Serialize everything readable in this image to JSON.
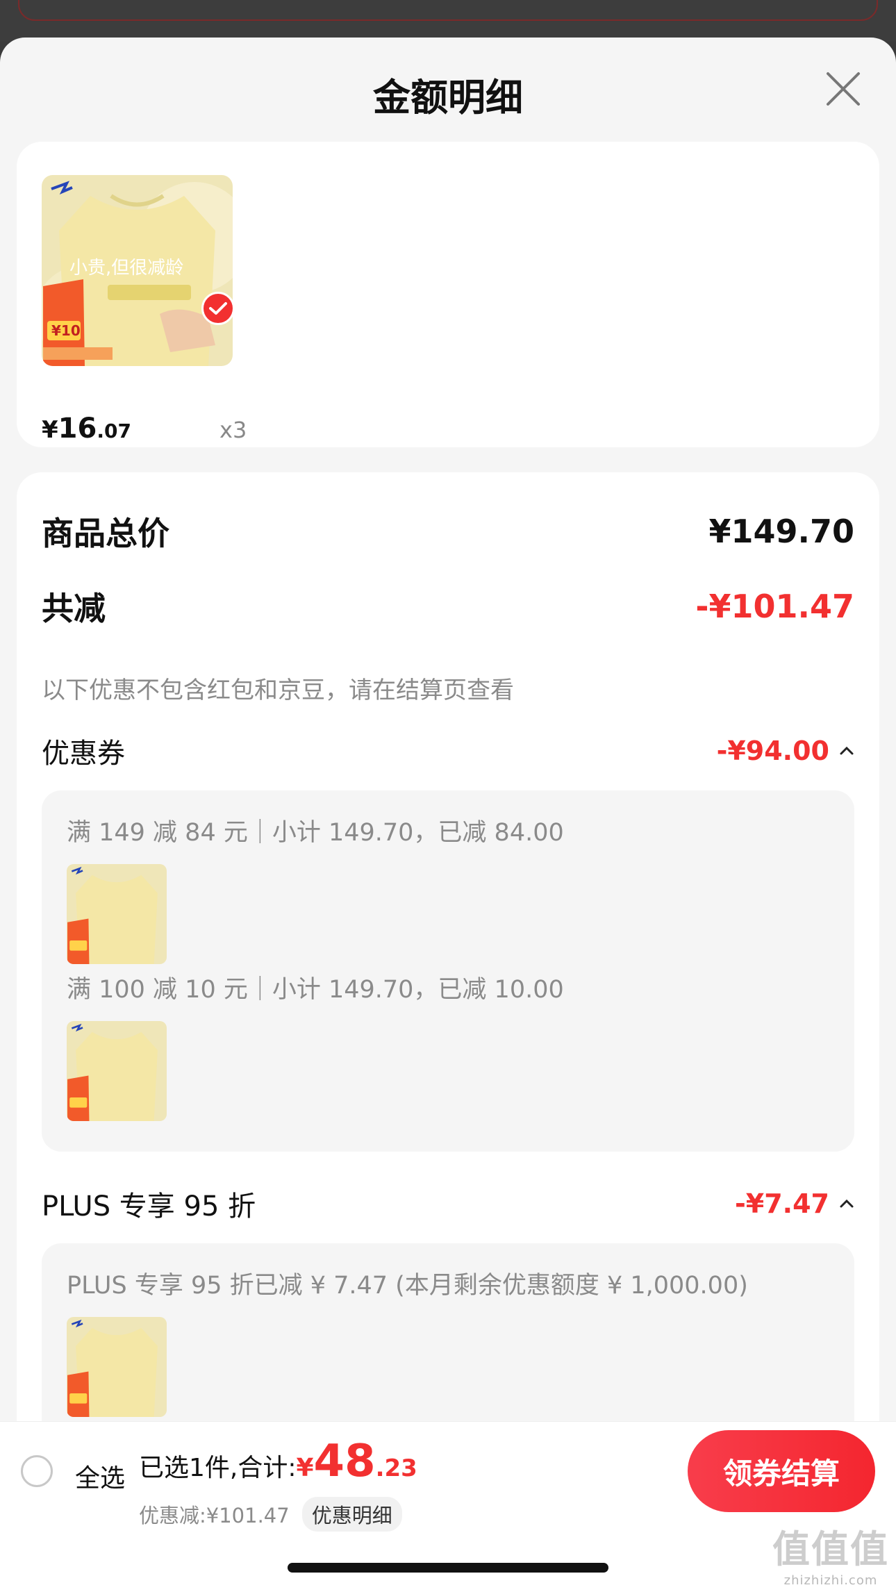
{
  "sheet": {
    "title": "金额明细"
  },
  "product": {
    "price_currency": "¥",
    "price_int": "16",
    "price_dec": ".07",
    "quantity": "x3",
    "image_text": "小贵,但很减龄"
  },
  "detail": {
    "total_label": "商品总价",
    "total_value": "¥149.70",
    "reduce_label": "共减",
    "reduce_value": "-¥101.47",
    "note": "以下优惠不包含红包和京豆，请在结算页查看",
    "coupon": {
      "label": "优惠券",
      "value": "-¥94.00",
      "lines": [
        "满 149 减 84 元｜小计 149.70，已减 84.00",
        "满 100 减 10 元｜小计 149.70，已减 10.00"
      ]
    },
    "plus": {
      "label": "PLUS 专享 95 折",
      "value": "-¥7.47",
      "lines": [
        "PLUS 专享 95 折已减 ¥ 7.47 (本月剩余优惠额度 ¥ 1,000.00)"
      ]
    }
  },
  "bottom": {
    "select_all": "全选",
    "summary_label": "已选1件,合计:",
    "currency": "¥",
    "total_int": "48",
    "total_dec": ".23",
    "discount_text": "优惠减:¥101.47",
    "detail_link": "优惠明细",
    "checkout": "领券结算"
  },
  "colors": {
    "accent": "#f23030",
    "sheet_bg": "#f5f5f5",
    "card_bg": "#ffffff"
  },
  "watermark": {
    "glyphs": "值值值",
    "site": "zhizhizhi.com"
  }
}
